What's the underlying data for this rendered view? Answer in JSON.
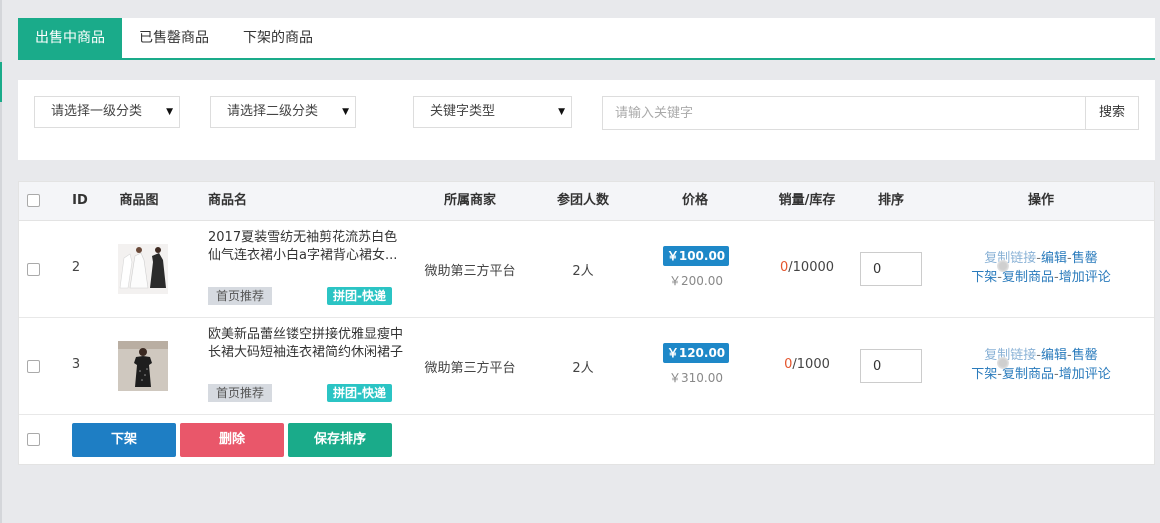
{
  "tabs": [
    {
      "label": "出售中商品",
      "active": true
    },
    {
      "label": "已售罄商品",
      "active": false
    },
    {
      "label": "下架的商品",
      "active": false
    }
  ],
  "filters": {
    "category1": "请选择一级分类",
    "category2": "请选择二级分类",
    "keyword_type": "关键字类型",
    "keyword_placeholder": "请输入关键字",
    "search_label": "搜索"
  },
  "table": {
    "headers": {
      "id": "ID",
      "image": "商品图",
      "name": "商品名",
      "merchant": "所属商家",
      "participants": "参团人数",
      "price": "价格",
      "sales_stock": "销量/库存",
      "sort": "排序",
      "actions": "操作"
    },
    "rows": [
      {
        "id": "2",
        "name": "2017夏装雪纺无袖剪花流苏白色仙气连衣裙小白a字裙背心裙女...",
        "tag_home": "首页推荐",
        "tag_group": "拼团-快递",
        "merchant": "微助第三方平台",
        "participants": "2人",
        "price": "￥100.00",
        "original_price": "￥200.00",
        "sold": "0",
        "stock": "/10000",
        "sort": "0"
      },
      {
        "id": "3",
        "name": "欧美新品蕾丝镂空拼接优雅显瘦中长裙大码短袖连衣裙简约休闲裙子",
        "tag_home": "首页推荐",
        "tag_group": "拼团-快递",
        "merchant": "微助第三方平台",
        "participants": "2人",
        "price": "￥120.00",
        "original_price": "￥310.00",
        "sold": "0",
        "stock": "/1000",
        "sort": "0"
      }
    ],
    "actions": {
      "copy_link": "复制链接",
      "edit": "编辑",
      "sold_out": "售罄",
      "off_shelf": "下架",
      "copy_product": "复制商品",
      "add_review": "增加评论",
      "sep": "-"
    }
  },
  "footer": {
    "off_shelf": "下架",
    "delete": "删除",
    "save_sort": "保存排序"
  },
  "colors": {
    "accent": "#1aab8a",
    "price_badge": "#1e88c8",
    "delete": "#e9576a",
    "link": "#2a7bbc",
    "sold": "#e4552d"
  }
}
